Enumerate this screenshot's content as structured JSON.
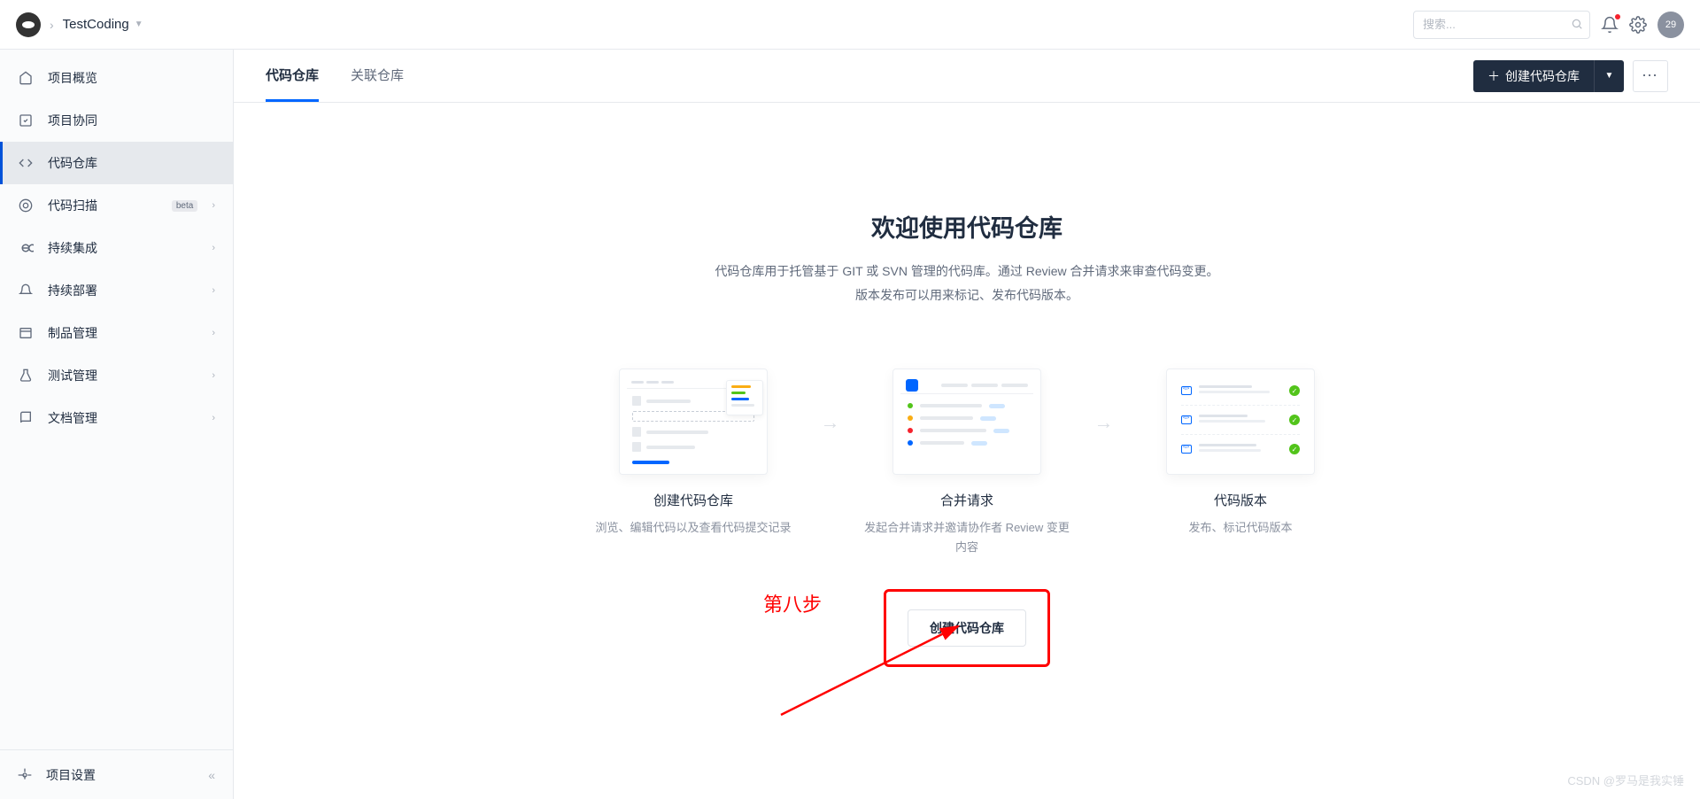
{
  "header": {
    "project_name": "TestCoding",
    "search_placeholder": "搜索...",
    "avatar_text": "29"
  },
  "sidebar": {
    "items": [
      {
        "label": "项目概览",
        "key": "overview",
        "expandable": false
      },
      {
        "label": "项目协同",
        "key": "collab",
        "expandable": false
      },
      {
        "label": "代码仓库",
        "key": "repo",
        "expandable": false,
        "active": true
      },
      {
        "label": "代码扫描",
        "key": "scan",
        "expandable": true,
        "badge": "beta"
      },
      {
        "label": "持续集成",
        "key": "ci",
        "expandable": true
      },
      {
        "label": "持续部署",
        "key": "cd",
        "expandable": true
      },
      {
        "label": "制品管理",
        "key": "artifact",
        "expandable": true
      },
      {
        "label": "测试管理",
        "key": "test",
        "expandable": true
      },
      {
        "label": "文档管理",
        "key": "doc",
        "expandable": true
      }
    ],
    "settings_label": "项目设置"
  },
  "tabs": {
    "items": [
      {
        "label": "代码仓库",
        "active": true
      },
      {
        "label": "关联仓库",
        "active": false
      }
    ],
    "create_button": "创建代码仓库"
  },
  "welcome": {
    "title": "欢迎使用代码仓库",
    "desc_line1": "代码仓库用于托管基于 GIT 或 SVN 管理的代码库。通过 Review 合并请求来审查代码变更。",
    "desc_line2": "版本发布可以用来标记、发布代码版本。",
    "features": [
      {
        "title": "创建代码仓库",
        "desc": "浏览、编辑代码以及查看代码提交记录"
      },
      {
        "title": "合并请求",
        "desc": "发起合并请求并邀请协作者 Review 变更内容"
      },
      {
        "title": "代码版本",
        "desc": "发布、标记代码版本"
      }
    ],
    "cta_label": "创建代码仓库"
  },
  "annotation": {
    "step_label": "第八步"
  },
  "watermark": "CSDN @罗马是我实锤"
}
